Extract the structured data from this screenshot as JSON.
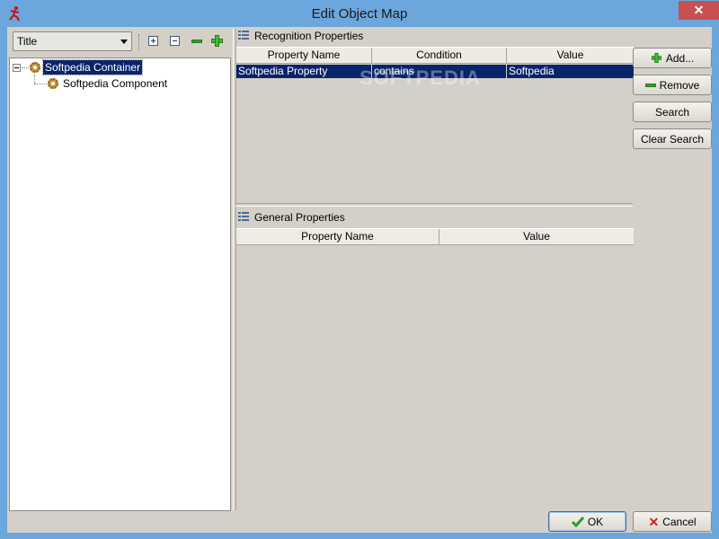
{
  "window": {
    "title": "Edit Object Map"
  },
  "icons": {
    "app": "runner-icon",
    "close": "close-icon",
    "expand_all": "expand-all-icon",
    "collapse_all": "collapse-all-icon",
    "remove": "minus-icon",
    "add": "plus-icon",
    "node": "gear-icon",
    "section": "list-icon",
    "ok": "checkmark-icon",
    "cancel": "x-icon"
  },
  "left_panel": {
    "filter_value": "Title",
    "tree": [
      {
        "label": "Softpedia Container",
        "selected": true,
        "expanded": true,
        "children": [
          {
            "label": "Softpedia Component",
            "selected": false
          }
        ]
      }
    ]
  },
  "recognition": {
    "title": "Recognition Properties",
    "columns": [
      "Property Name",
      "Condition",
      "Value"
    ],
    "rows": [
      {
        "property": "Softpedia Property",
        "condition": "contains",
        "value": "Softpedia",
        "selected": true
      }
    ],
    "buttons": {
      "add": "Add...",
      "remove": "Remove",
      "search": "Search",
      "clear_search": "Clear Search"
    }
  },
  "general": {
    "title": "General Properties",
    "columns": [
      "Property Name",
      "Value"
    ],
    "rows": []
  },
  "watermark": "SOFTPEDIA",
  "footer": {
    "ok": "OK",
    "cancel": "Cancel"
  },
  "colors": {
    "titlebar": "#6ba6dc",
    "client": "#d4d0c8",
    "selection": "#0a246a",
    "close": "#c75050"
  }
}
